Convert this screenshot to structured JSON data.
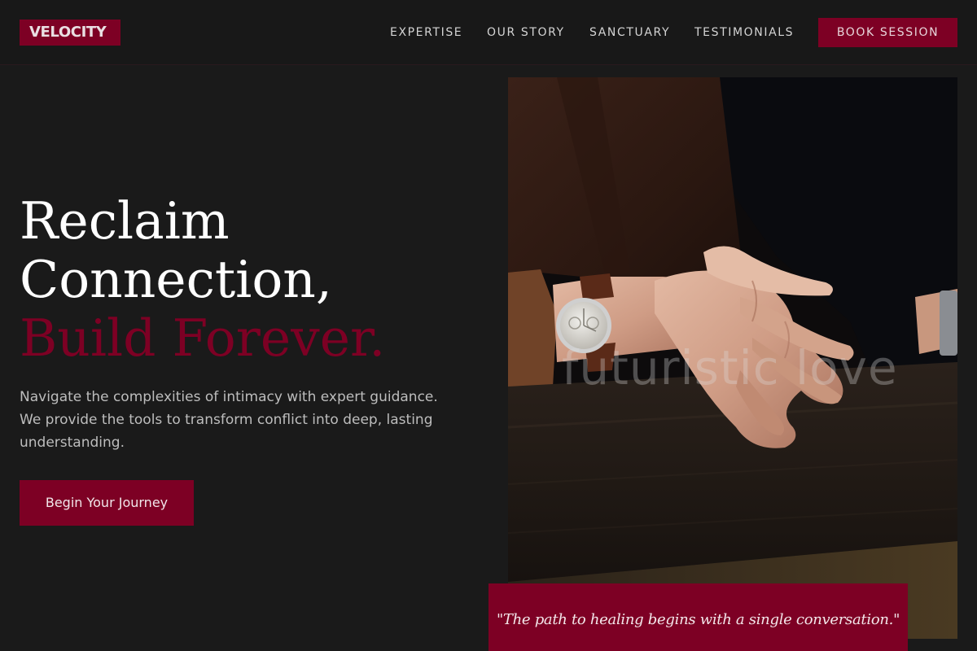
{
  "brand": {
    "logo_text": "VELOCITY",
    "accent_color": "#7d0024",
    "background_color": "#1a1a1a"
  },
  "nav": {
    "items": [
      {
        "label": "EXPERTISE"
      },
      {
        "label": "OUR STORY"
      },
      {
        "label": "SANCTUARY"
      },
      {
        "label": "TESTIMONIALS"
      }
    ],
    "cta_label": "BOOK SESSION"
  },
  "hero": {
    "headline_line1": "Reclaim",
    "headline_line2": "Connection,",
    "headline_accent": "Build Forever.",
    "description": "Navigate the complexities of intimacy with expert guidance. We provide the tools to transform conflict into deep, lasting understanding.",
    "cta_label": "Begin Your Journey"
  },
  "image": {
    "subject": "photo-clasped-hands-wristwatch",
    "watermark": "futuristic love"
  },
  "quote": {
    "text": "\"The path to healing begins with a single conversation.\""
  }
}
